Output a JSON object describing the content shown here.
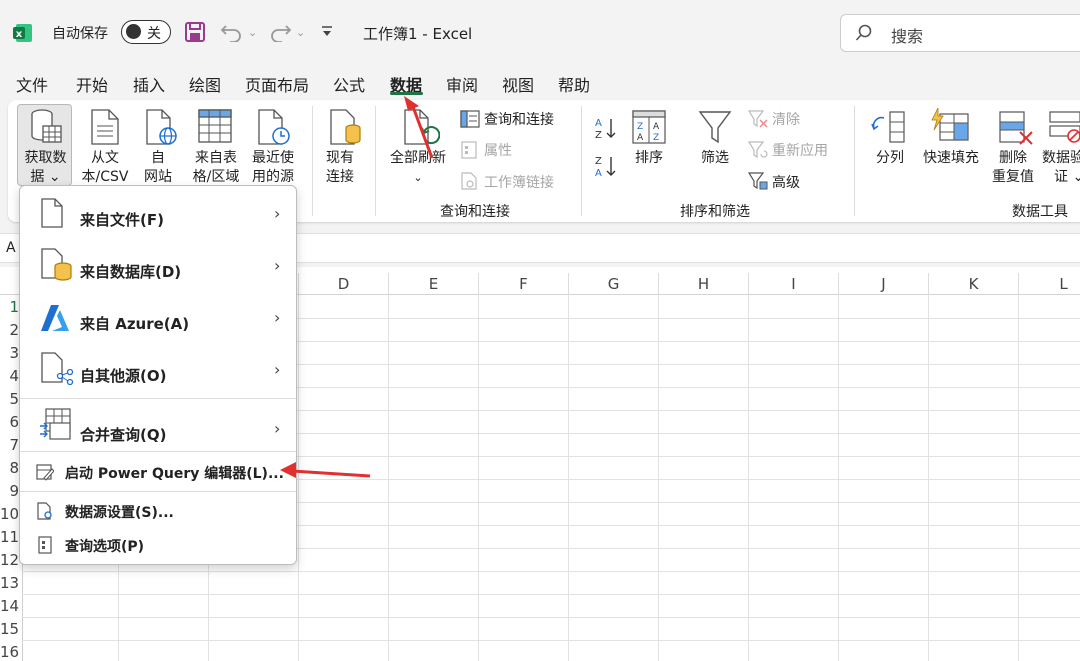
{
  "titlebar": {
    "autosave_label": "自动保存",
    "toggle_state": "关",
    "doc_title": "工作簿1  -  Excel",
    "search_placeholder": "搜索"
  },
  "tabs": [
    {
      "label": "文件"
    },
    {
      "label": "开始"
    },
    {
      "label": "插入"
    },
    {
      "label": "绘图"
    },
    {
      "label": "页面布局"
    },
    {
      "label": "公式"
    },
    {
      "label": "数据",
      "active": true
    },
    {
      "label": "审阅"
    },
    {
      "label": "视图"
    },
    {
      "label": "帮助"
    }
  ],
  "ribbon": {
    "get_data": {
      "line1": "获取数",
      "line2": "据 ⌄"
    },
    "from_text": {
      "line1": "从文",
      "line2": "本/CSV"
    },
    "from_web": {
      "line1": "自",
      "line2": "网站"
    },
    "from_table": {
      "line1": "来自表",
      "line2": "格/区域"
    },
    "recent_sources": {
      "line1": "最近使",
      "line2": "用的源"
    },
    "existing": {
      "line1": "现有",
      "line2": "连接"
    },
    "refresh_all": {
      "line1": "全部刷新",
      "line2": "⌄"
    },
    "queries_connections": "查询和连接",
    "properties": "属性",
    "workbook_links": "工作簿链接",
    "group_queries": "查询和连接",
    "sort_label": "排序",
    "filter_label": "筛选",
    "clear": "清除",
    "reapply": "重新应用",
    "advanced": "高级",
    "group_sort_filter": "排序和筛选",
    "split": "分列",
    "flash_fill": "快速填充",
    "remove_dup": {
      "line1": "删除",
      "line2": "重复值"
    },
    "data_validation": {
      "line1": "数据验",
      "line2": "证 ⌄"
    },
    "group_data_tools": "数据工具"
  },
  "namebox_letter": "A",
  "columns": [
    "D",
    "E",
    "F",
    "G",
    "H",
    "I",
    "J",
    "K",
    "L"
  ],
  "rows": [
    "1",
    "2",
    "3",
    "4",
    "5",
    "6",
    "7",
    "8",
    "9",
    "10",
    "11",
    "12",
    "13",
    "14",
    "15",
    "16"
  ],
  "menu": {
    "items": [
      {
        "label": "来自文件(F)",
        "icon": "file-icon"
      },
      {
        "label": "来自数据库(D)",
        "icon": "database-icon"
      },
      {
        "label": "来自 Azure(A)",
        "icon": "azure-icon"
      },
      {
        "label": "自其他源(O)",
        "icon": "other-source-icon"
      },
      {
        "label": "合并查询(Q)",
        "icon": "merge-query-icon"
      }
    ],
    "chevron": "›",
    "actions": [
      {
        "label": "启动 Power Query 编辑器(L)...",
        "icon": "power-query-icon"
      },
      {
        "label": "数据源设置(S)...",
        "icon": "datasource-settings-icon"
      },
      {
        "label": "查询选项(P)",
        "icon": "query-options-icon"
      }
    ]
  },
  "colors": {
    "excel_green": "#217346",
    "annotation_red": "#e03030",
    "save_purple": "#9b3b8f"
  }
}
